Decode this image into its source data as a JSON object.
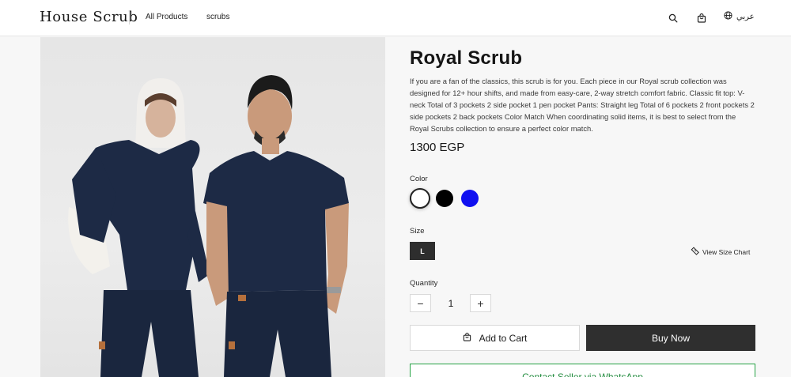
{
  "header": {
    "logo": "House Scrub",
    "nav": [
      "All Products",
      "scrubs"
    ],
    "language": "عربي",
    "icons": [
      "search-icon",
      "bag-icon",
      "globe-icon"
    ]
  },
  "product": {
    "image_icon": "product-photo-two-models-navy-scrubs",
    "title": "Royal Scrub",
    "description": "If you are a fan of the classics, this scrub is for you. Each piece in our Royal scrub collection was designed for 12+ hour shifts, and made from easy-care, 2-way stretch comfort fabric. Classic fit top: V-neck Total of 3 pockets 2 side pocket 1 pen pocket Pants: Straight leg Total of 6 pockets 2 front pockets 2 side pockets 2 back pockets Color Match When coordinating solid items, it is best to select from the Royal Scrubs collection to ensure a perfect color match.",
    "price": "1300 EGP",
    "color_label": "Color",
    "colors": [
      {
        "name": "white",
        "hex": "#ffffff",
        "selected": true
      },
      {
        "name": "black",
        "hex": "#000000",
        "selected": false
      },
      {
        "name": "blue",
        "hex": "#1010f0",
        "selected": false
      }
    ],
    "size_label": "Size",
    "sizes": [
      {
        "label": "L",
        "selected": true
      }
    ],
    "size_chart_label": "View Size Chart",
    "quantity_label": "Quantity",
    "quantity": "1",
    "minus": "−",
    "plus": "+",
    "add_to_cart": "Add to Cart",
    "buy_now": "Buy Now",
    "whatsapp": "Contact Seller via WhatsApp"
  },
  "colors": {
    "dark_button": "#2f2f2f",
    "whatsapp_green": "#25a244",
    "scrub_navy": "#1d2a45"
  }
}
